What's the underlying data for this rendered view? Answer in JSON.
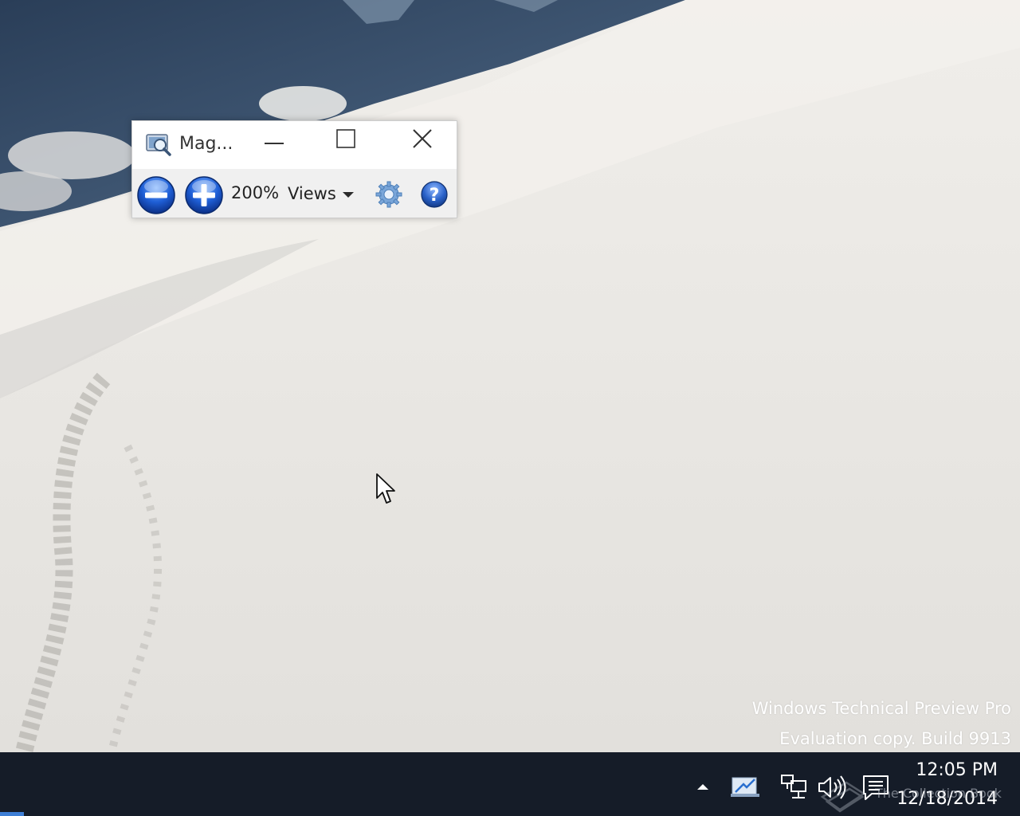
{
  "desktop": {
    "watermark_line1": "Windows Technical Preview Pro",
    "watermark_line2": "Evaluation copy. Build 9913"
  },
  "magnifier": {
    "title": "Mag...",
    "zoom_level": "200%",
    "views_label": "Views",
    "icons": {
      "app": "magnifier-app-icon",
      "minimize": "minimize-icon",
      "maximize": "maximize-icon",
      "close": "close-icon",
      "zoom_out": "zoom-out-icon",
      "zoom_in": "zoom-in-icon",
      "options": "gear-icon",
      "help": "help-icon"
    }
  },
  "taskbar": {
    "time": "12:05 PM",
    "date": "12/18/2014",
    "tray_icons": [
      "show-hidden-icons-chevron",
      "pen-ink-icon",
      "network-icon",
      "volume-icon",
      "action-center-icon"
    ],
    "overlay_logo_text": "The Collection Book",
    "colors": {
      "background": "#151c28",
      "start_accent": "#3e7fd6"
    }
  }
}
